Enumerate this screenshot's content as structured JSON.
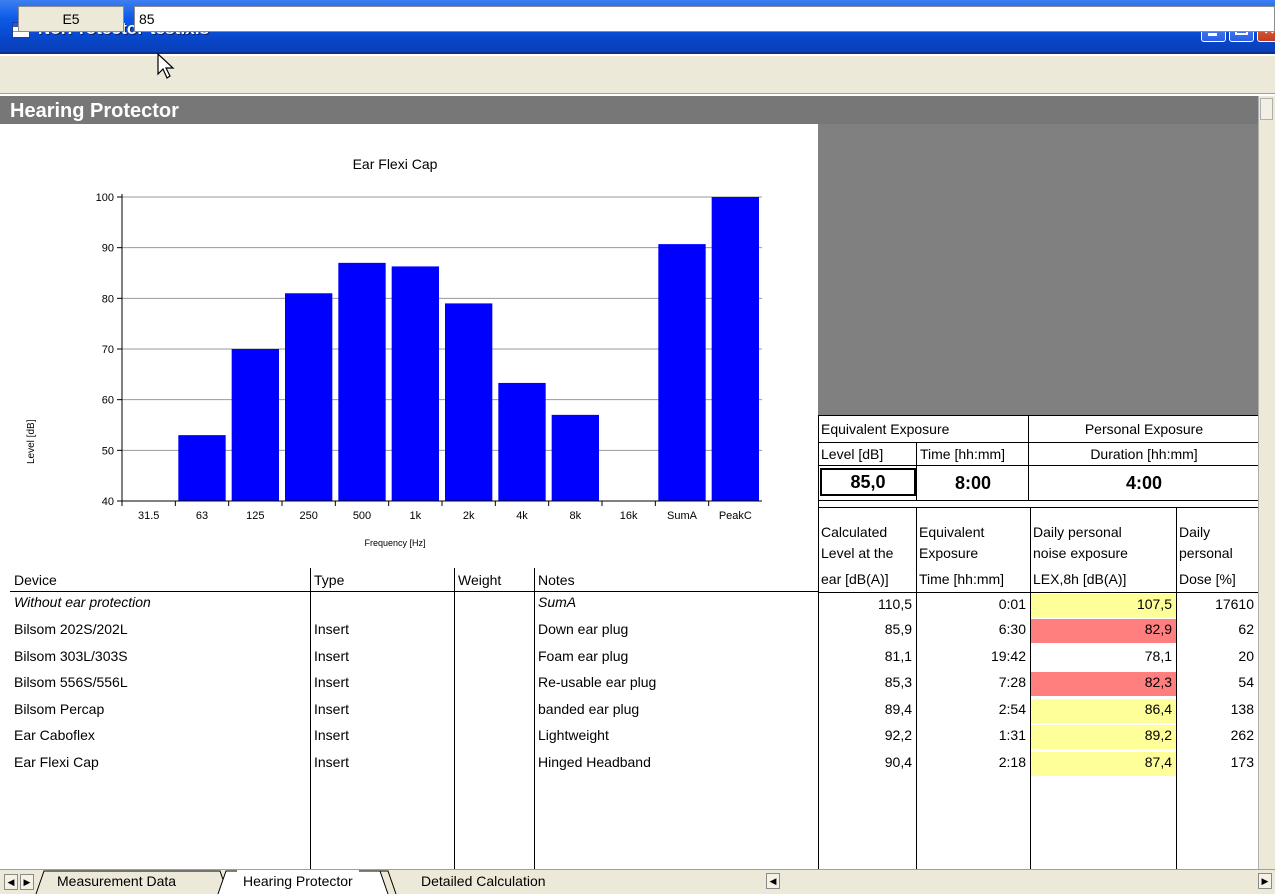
{
  "window": {
    "title": "NorProtector-test.xls",
    "buttons": {
      "minimize": "minimize-icon",
      "maximize": "maximize-icon",
      "close": "close-icon"
    }
  },
  "formula_bar": {
    "cell_ref": "E5",
    "value": "85"
  },
  "sheet": {
    "title": "Hearing Protector"
  },
  "chart_data": {
    "type": "bar",
    "title": "Ear Flexi Cap",
    "xlabel": "Frequency [Hz]",
    "ylabel": "Level [dB]",
    "ylim": [
      40,
      100
    ],
    "yticks": [
      40,
      50,
      60,
      70,
      80,
      90,
      100
    ],
    "categories": [
      "31.5",
      "63",
      "125",
      "250",
      "500",
      "1k",
      "2k",
      "4k",
      "8k",
      "16k",
      "SumA",
      "PeakC"
    ],
    "values": [
      null,
      53,
      70,
      81,
      87,
      86.3,
      79,
      63.3,
      57,
      null,
      90.7,
      100
    ],
    "color": "#0000ff",
    "grid": true
  },
  "table": {
    "headers": [
      "Device",
      "Type",
      "Weight",
      "Notes"
    ],
    "rows": [
      {
        "device": "Without ear protection",
        "type": "",
        "weight": "",
        "notes": "SumA",
        "italic": true
      },
      {
        "device": "Bilsom 202S/202L",
        "type": "Insert",
        "weight": "",
        "notes": "Down ear plug"
      },
      {
        "device": "Bilsom 303L/303S",
        "type": "Insert",
        "weight": "",
        "notes": "Foam ear plug"
      },
      {
        "device": "Bilsom 556S/556L",
        "type": "Insert",
        "weight": "",
        "notes": "Re-usable ear plug"
      },
      {
        "device": "Bilsom Percap",
        "type": "Insert",
        "weight": "",
        "notes": "banded ear plug"
      },
      {
        "device": "Ear Caboflex",
        "type": "Insert",
        "weight": "",
        "notes": "Lightweight"
      },
      {
        "device": "Ear Flexi Cap",
        "type": "Insert",
        "weight": "",
        "notes": "Hinged Headband"
      }
    ]
  },
  "exposure": {
    "equivalent_header": "Equivalent Exposure",
    "personal_header": "Personal Exposure",
    "level_label": "Level [dB]",
    "time_label": "Time [hh:mm]",
    "duration_label": "Duration [hh:mm]",
    "level_value": "85,0",
    "time_value": "8:00",
    "duration_value": "4:00",
    "col_headers": {
      "calc_line1": "Calculated",
      "calc_line2": "Level at the",
      "calc_line3": "ear [dB(A)]",
      "eq_line1": "Equivalent",
      "eq_line2": "Exposure",
      "eq_line3": "Time [hh:mm]",
      "lex_line1": "Daily personal",
      "lex_line2": "noise exposure",
      "lex_line3": "LEX,8h   [dB(A)]",
      "dose_line1": "Daily",
      "dose_line2": "personal",
      "dose_line3": "Dose [%]"
    },
    "rows": [
      {
        "level": "110,5",
        "time": "0:01",
        "lex": "107,5",
        "dose": "17610",
        "color": "#ffff99"
      },
      {
        "level": "85,9",
        "time": "6:30",
        "lex": "82,9",
        "dose": "62",
        "color": "#ff7f7f"
      },
      {
        "level": "81,1",
        "time": "19:42",
        "lex": "78,1",
        "dose": "20",
        "color": "#ffffff"
      },
      {
        "level": "85,3",
        "time": "7:28",
        "lex": "82,3",
        "dose": "54",
        "color": "#ff7f7f"
      },
      {
        "level": "89,4",
        "time": "2:54",
        "lex": "86,4",
        "dose": "138",
        "color": "#ffff99"
      },
      {
        "level": "92,2",
        "time": "1:31",
        "lex": "89,2",
        "dose": "262",
        "color": "#ffff99"
      },
      {
        "level": "90,4",
        "time": "2:18",
        "lex": "87,4",
        "dose": "173",
        "color": "#ffff99"
      }
    ]
  },
  "tabs": [
    "Measurement Data",
    "Hearing Protector",
    "Detailed Calculation"
  ],
  "active_tab": "Hearing Protector"
}
